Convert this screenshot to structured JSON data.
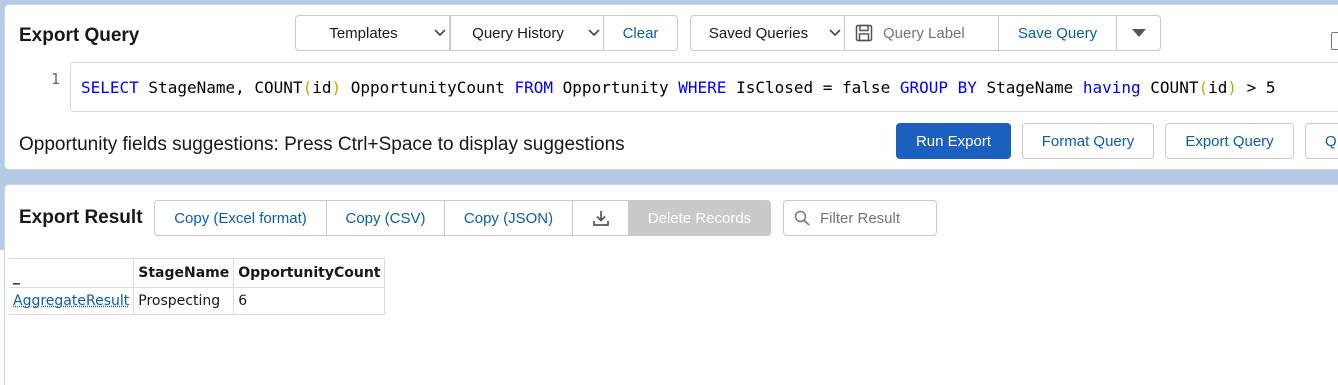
{
  "query_panel": {
    "title": "Export Query",
    "templates_label": "Templates",
    "query_history_label": "Query History",
    "clear_label": "Clear",
    "saved_queries_label": "Saved Queries",
    "query_label_placeholder": "Query Label",
    "save_query_label": "Save Query",
    "editor": {
      "line_number": "1",
      "tokens": {
        "t1": "SELECT",
        "t2": " StageName, COUNT",
        "t3": "(",
        "t4": "id",
        "t5": ")",
        "t6": " OpportunityCount ",
        "t7": "FROM",
        "t8": " Opportunity ",
        "t9": "WHERE",
        "t10": " IsClosed = false ",
        "t11": "GROUP BY",
        "t12": " StageName ",
        "t13": "having",
        "t14": " COUNT",
        "t15": "(",
        "t16": "id",
        "t17": ")",
        "t18": " > 5"
      }
    },
    "suggestion_hint": "Opportunity fields suggestions: Press Ctrl+Space to display suggestions",
    "run_export_label": "Run Export",
    "format_query_label": "Format Query",
    "export_query_label": "Export Query",
    "partial_button_label": "Q"
  },
  "result_panel": {
    "title": "Export Result",
    "copy_excel_label": "Copy (Excel format)",
    "copy_csv_label": "Copy (CSV)",
    "copy_json_label": "Copy (JSON)",
    "delete_records_label": "Delete Records",
    "filter_placeholder": "Filter Result",
    "table": {
      "columns": [
        "_",
        "StageName",
        "OpportunityCount"
      ],
      "rows": [
        [
          "AggregateResult",
          "Prospecting",
          "6"
        ]
      ]
    }
  },
  "colors": {
    "brand": "#1b5fbf",
    "link": "#0b5cab",
    "keyword": "#0000ff",
    "paren": "#c9a800",
    "background_band": "#b4cbe6"
  },
  "icons": [
    "chevron-down-icon",
    "save-disk-icon",
    "caret-down-icon",
    "download-icon",
    "search-icon"
  ]
}
